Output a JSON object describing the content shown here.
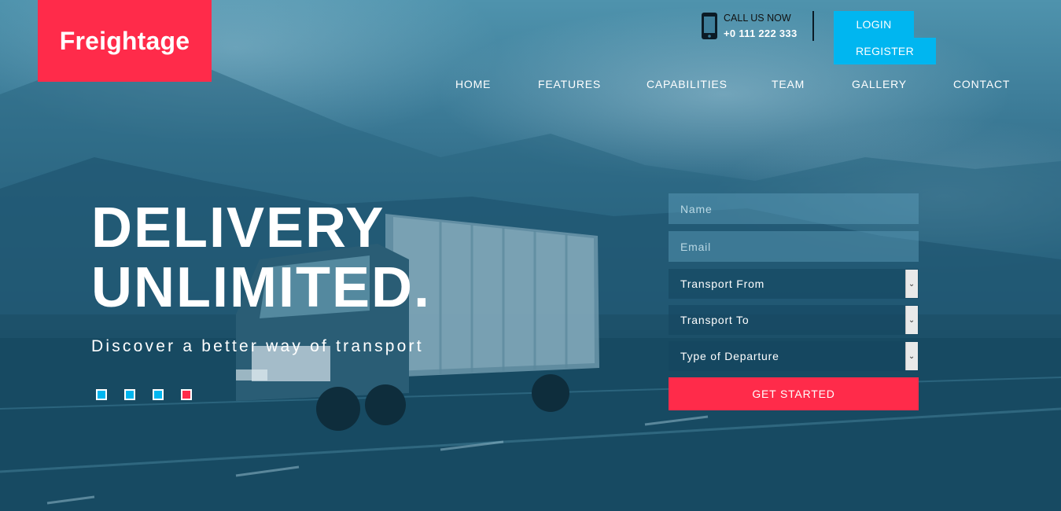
{
  "brand": {
    "logo_text": "Freightage"
  },
  "contact": {
    "label": "CALL US NOW",
    "phone": "+0 111 222 333"
  },
  "auth": {
    "login_label": "LOGIN",
    "register_label": "REGISTER"
  },
  "nav": {
    "items": [
      {
        "label": "HOME"
      },
      {
        "label": "FEATURES"
      },
      {
        "label": "CAPABILITIES"
      },
      {
        "label": "TEAM"
      },
      {
        "label": "GALLERY"
      },
      {
        "label": "CONTACT"
      }
    ]
  },
  "hero": {
    "headline_line1": "DELIVERY",
    "headline_line2": "UNLIMITED.",
    "tagline": "Discover a better way of transport",
    "slider": {
      "count": 4,
      "active_index": 3
    }
  },
  "quote_form": {
    "name_placeholder": "Name",
    "email_placeholder": "Email",
    "transport_from": "Transport From",
    "transport_to": "Transport To",
    "departure_type": "Type of Departure",
    "submit_label": "GET STARTED"
  },
  "colors": {
    "accent_red": "#ff2b4a",
    "accent_blue": "#00b6f0",
    "overlay_teal": "#1f5a73"
  }
}
